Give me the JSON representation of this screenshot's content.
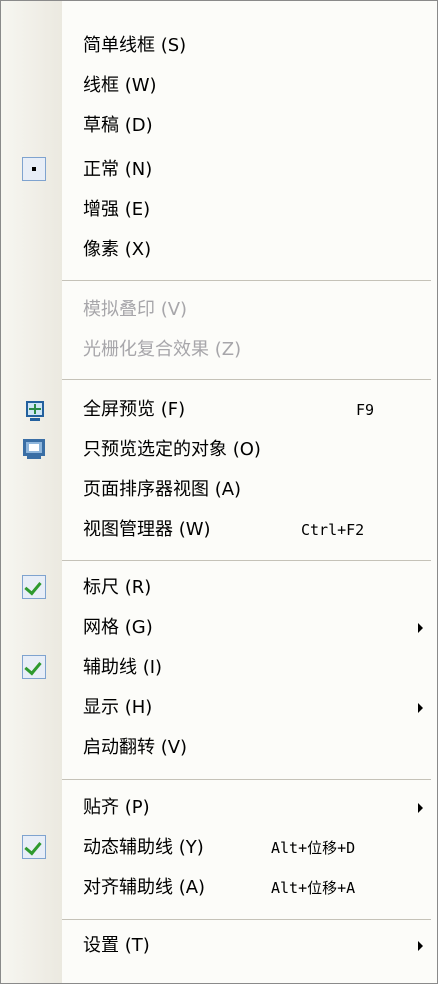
{
  "menu": {
    "items": [
      {
        "label": "简单线框 (S)"
      },
      {
        "label": "线框 (W)"
      },
      {
        "label": "草稿 (D)"
      },
      {
        "label": "正常 (N)"
      },
      {
        "label": "增强 (E)"
      },
      {
        "label": "像素 (X)"
      },
      {
        "label": "模拟叠印 (V)"
      },
      {
        "label": "光栅化复合效果 (Z)"
      },
      {
        "label": "全屏预览 (F)",
        "shortcut": "F9"
      },
      {
        "label": "只预览选定的对象 (O)"
      },
      {
        "label": "页面排序器视图 (A)"
      },
      {
        "label": "视图管理器 (W)",
        "shortcut": "Ctrl+F2"
      },
      {
        "label": "标尺 (R)"
      },
      {
        "label": "网格 (G)"
      },
      {
        "label": "辅助线 (I)"
      },
      {
        "label": "显示 (H)"
      },
      {
        "label": "启动翻转 (V)"
      },
      {
        "label": "贴齐 (P)"
      },
      {
        "label": "动态辅助线 (Y)",
        "shortcut": "Alt+位移+D"
      },
      {
        "label": "对齐辅助线 (A)",
        "shortcut": "Alt+位移+A"
      },
      {
        "label": "设置 (T)"
      }
    ],
    "states": {
      "normal_selected": true,
      "simulate_overprint_enabled": false,
      "rasterize_composite_enabled": false,
      "rulers_checked": true,
      "guidelines_checked": true,
      "dynamic_guides_checked": true
    },
    "icons": {
      "fullscreen": "fullscreen-preview-icon",
      "preview_selected": "preview-selected-icon",
      "radio": "radio-dot-icon",
      "check": "checkmark-icon",
      "submenu": "submenu-arrow-icon"
    },
    "colors": {
      "gutter": "#ebe9e0",
      "disabled_text": "#a7a6aa",
      "check_green": "#2f9a2f",
      "check_box_border": "#7fa3cf"
    }
  }
}
